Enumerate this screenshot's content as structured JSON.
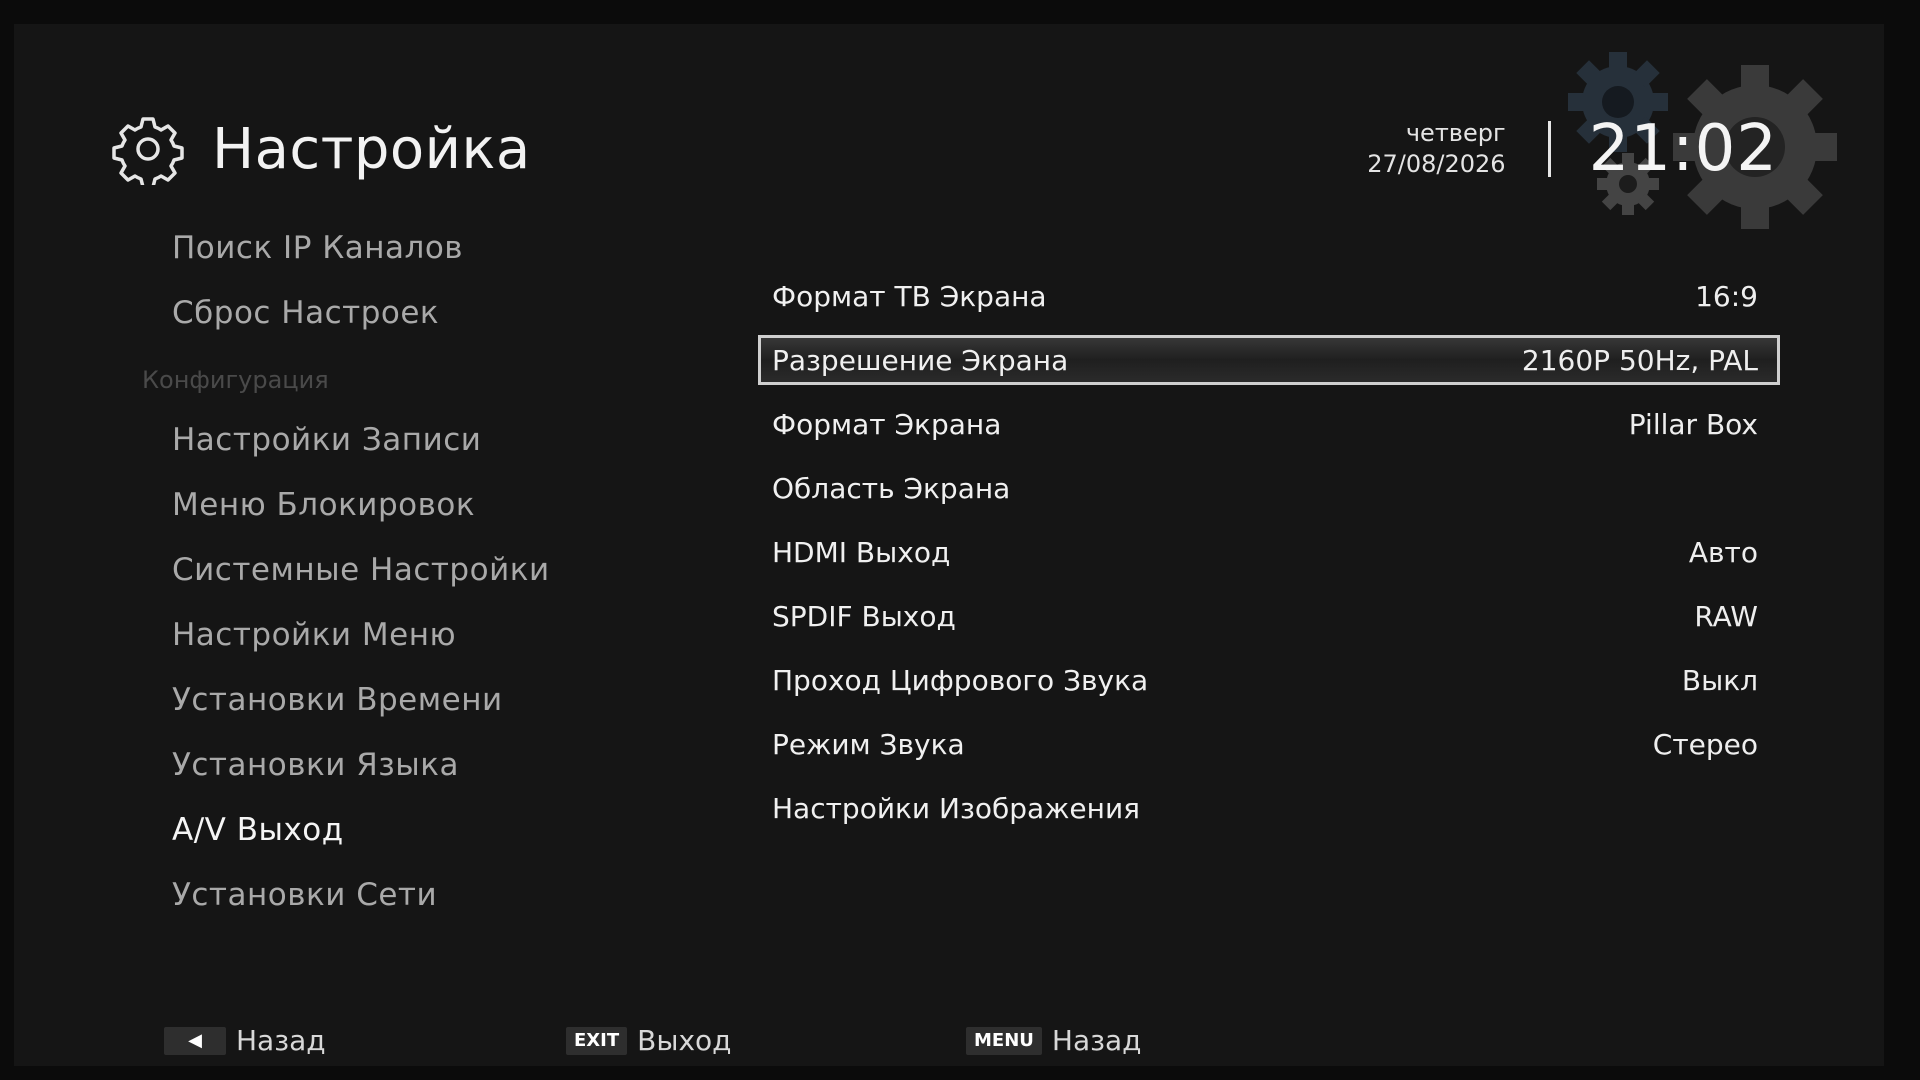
{
  "header": {
    "title": "Настройка",
    "title_icon": "gear-icon",
    "weekday": "четверг",
    "date": "27/08/2026",
    "time": "21:02"
  },
  "sidebar": {
    "items_top": [
      {
        "label": "Поиск IP Каналов"
      },
      {
        "label": "Сброс Настроек"
      }
    ],
    "section_label": "Конфигурация",
    "items": [
      {
        "label": "Настройки Записи"
      },
      {
        "label": "Меню Блокировок"
      },
      {
        "label": "Системные Настройки"
      },
      {
        "label": "Настройки Меню"
      },
      {
        "label": "Установки Времени"
      },
      {
        "label": "Установки Языка"
      },
      {
        "label": "A/V Выход",
        "active": true
      },
      {
        "label": "Установки Сети"
      }
    ]
  },
  "settings": [
    {
      "label": "Формат ТВ Экрана",
      "value": "16:9"
    },
    {
      "label": "Разрешение Экрана",
      "value": "2160P 50Hz, PAL",
      "selected": true
    },
    {
      "label": "Формат Экрана",
      "value": "Pillar Box"
    },
    {
      "label": "Область Экрана",
      "value": ""
    },
    {
      "label": "HDMI Выход",
      "value": "Авто"
    },
    {
      "label": "SPDIF Выход",
      "value": "RAW"
    },
    {
      "label": "Проход Цифрового Звука",
      "value": "Выкл"
    },
    {
      "label": "Режим Звука",
      "value": "Стерео"
    },
    {
      "label": "Настройки Изображения",
      "value": ""
    }
  ],
  "footer": {
    "back": {
      "key_icon": "left-arrow-icon",
      "label": "Назад"
    },
    "exit": {
      "key": "EXIT",
      "label": "Выход"
    },
    "menu": {
      "key": "MENU",
      "label": "Назад"
    }
  },
  "colors": {
    "background": "#151515",
    "text": "#f0f0f0",
    "muted": "#a9a9a9",
    "section": "#4a4a4a",
    "selection_border": "#cfcfcf"
  }
}
